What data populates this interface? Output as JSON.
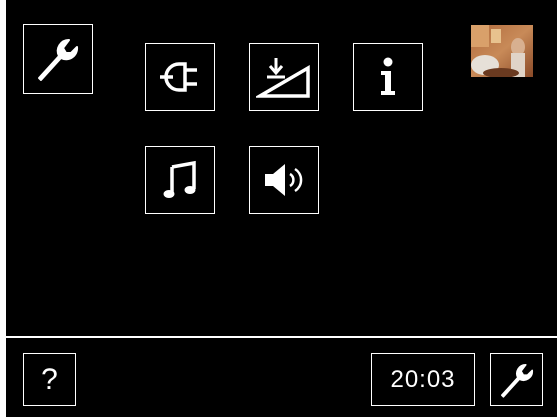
{
  "colors": {
    "background": "#000000",
    "foreground": "#ffffff"
  },
  "menu": {
    "settings_icon": "wrench-icon",
    "items": [
      {
        "name": "power",
        "icon": "plug-icon"
      },
      {
        "name": "brightness",
        "icon": "brightness-ramp-icon"
      },
      {
        "name": "information",
        "icon": "info-icon"
      },
      {
        "name": "music",
        "icon": "music-note-icon"
      },
      {
        "name": "volume",
        "icon": "speaker-icon"
      }
    ]
  },
  "preview": {
    "icon": "video-thumbnail"
  },
  "footer": {
    "help_label": "?",
    "time": "20:03",
    "settings_icon": "wrench-icon"
  }
}
